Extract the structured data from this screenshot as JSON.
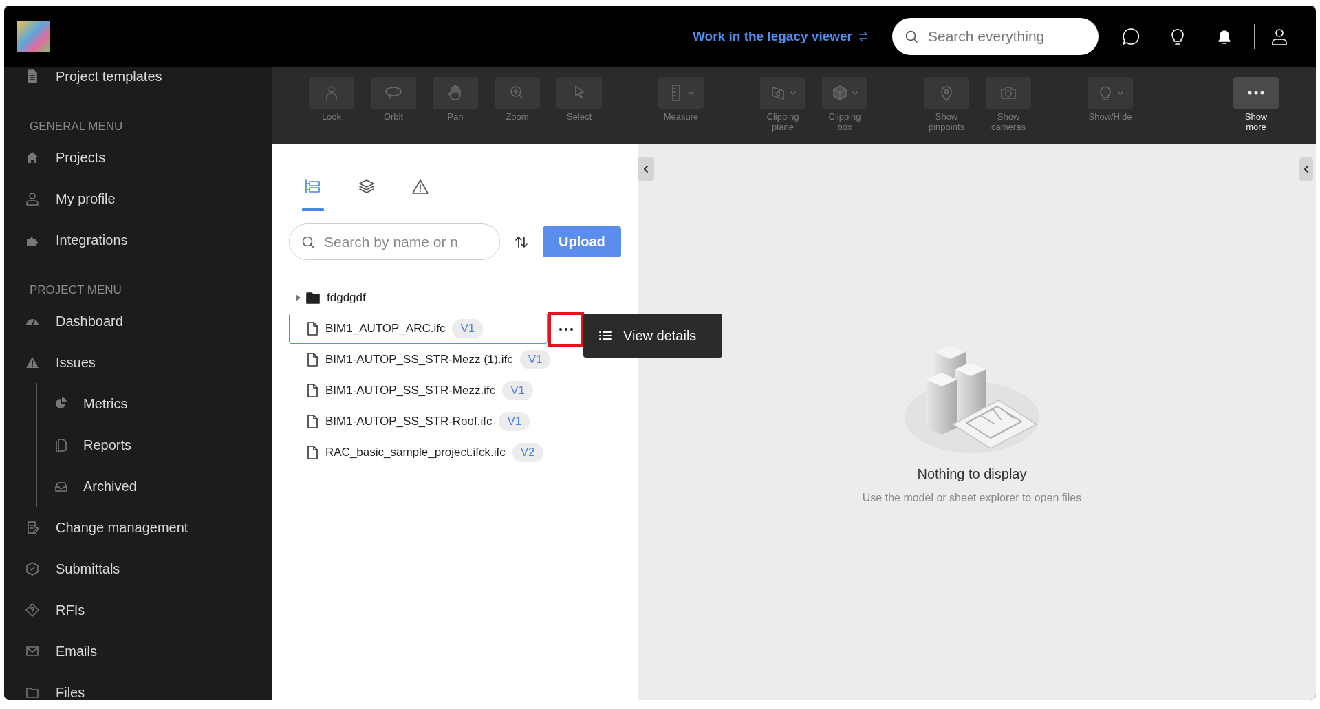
{
  "header": {
    "legacy_link": "Work in the legacy viewer",
    "search": {
      "placeholder": "Search everything"
    }
  },
  "sidebar": {
    "items": [
      {
        "kind": "item",
        "label": "Project templates"
      },
      {
        "kind": "heading",
        "label": "GENERAL MENU"
      },
      {
        "kind": "item",
        "label": "Projects"
      },
      {
        "kind": "item",
        "label": "My profile"
      },
      {
        "kind": "item",
        "label": "Integrations"
      },
      {
        "kind": "heading",
        "label": "PROJECT MENU"
      },
      {
        "kind": "item",
        "label": "Dashboard"
      },
      {
        "kind": "item",
        "label": "Issues",
        "children": [
          {
            "label": "Metrics"
          },
          {
            "label": "Reports"
          },
          {
            "label": "Archived"
          }
        ]
      },
      {
        "kind": "item",
        "label": "Change management"
      },
      {
        "kind": "item",
        "label": "Submittals"
      },
      {
        "kind": "item",
        "label": "RFIs"
      },
      {
        "kind": "item",
        "label": "Emails"
      },
      {
        "kind": "item",
        "label": "Files"
      }
    ]
  },
  "toolbar": {
    "groups": [
      [
        {
          "label": "Look",
          "disabled": true,
          "dropdown": false
        },
        {
          "label": "Orbit",
          "disabled": true,
          "dropdown": false
        },
        {
          "label": "Pan",
          "disabled": true,
          "dropdown": false
        },
        {
          "label": "Zoom",
          "disabled": true,
          "dropdown": false
        },
        {
          "label": "Select",
          "disabled": true,
          "dropdown": false
        }
      ],
      [
        {
          "label": "Measure",
          "disabled": true,
          "dropdown": true
        }
      ],
      [
        {
          "label": "Clipping plane",
          "disabled": true,
          "dropdown": true
        },
        {
          "label": "Clipping box",
          "disabled": true,
          "dropdown": true
        }
      ],
      [
        {
          "label": "Show pinpoints",
          "disabled": true,
          "dropdown": false
        },
        {
          "label": "Show cameras",
          "disabled": true,
          "dropdown": false
        }
      ],
      [
        {
          "label": "Show/Hide",
          "disabled": true,
          "dropdown": true
        }
      ],
      [
        {
          "label": "Show more",
          "disabled": false,
          "dropdown": false
        }
      ]
    ]
  },
  "explorer": {
    "tabs": [
      {
        "selected": true
      },
      {
        "selected": false
      },
      {
        "selected": false
      }
    ],
    "search": {
      "placeholder": "Search by name or n"
    },
    "upload": "Upload",
    "tree": [
      {
        "kind": "folder",
        "name": "fdgdgdf",
        "expanded": false,
        "selected": false
      },
      {
        "kind": "file",
        "name": "BIM1_AUTOP_ARC.ifc",
        "version": "V1",
        "selected": true,
        "menu": [
          {
            "label": "View details"
          }
        ]
      },
      {
        "kind": "file",
        "name": "BIM1-AUTOP_SS_STR-Mezz (1).ifc",
        "version": "V1",
        "selected": false
      },
      {
        "kind": "file",
        "name": "BIM1-AUTOP_SS_STR-Mezz.ifc",
        "version": "V1",
        "selected": false
      },
      {
        "kind": "file",
        "name": "BIM1-AUTOP_SS_STR-Roof.ifc",
        "version": "V1",
        "selected": false
      },
      {
        "kind": "file",
        "name": "RAC_basic_sample_project.ifck.ifc",
        "version": "V2",
        "selected": false
      }
    ]
  },
  "viewer": {
    "empty_title": "Nothing to display",
    "empty_text": "Use the model or sheet explorer to open files"
  }
}
